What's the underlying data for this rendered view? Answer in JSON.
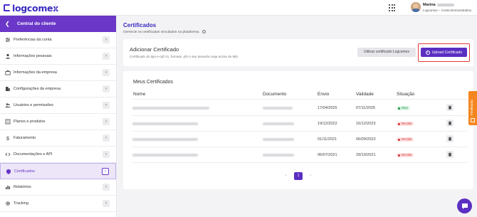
{
  "header": {
    "logo_text": "logcomex",
    "user_name": "Marina",
    "user_company": "Logcomex – Conta Demonstrativa"
  },
  "sidebar": {
    "title": "Central do cliente",
    "items": [
      {
        "label": "Preferências da conta",
        "icon": "sliders-icon"
      },
      {
        "label": "Informações pessoais",
        "icon": "user-icon"
      },
      {
        "label": "Informações da empresa",
        "icon": "briefcase-icon"
      },
      {
        "label": "Configurações da empresa",
        "icon": "building-icon"
      },
      {
        "label": "Usuários e permissões",
        "icon": "users-icon"
      },
      {
        "label": "Planos e produtos",
        "icon": "list-icon"
      },
      {
        "label": "Faturamento",
        "icon": "dollar-icon"
      },
      {
        "label": "Documentações e API",
        "icon": "code-icon"
      },
      {
        "label": "Certificados",
        "icon": "shield-icon",
        "active": true
      },
      {
        "label": "Relatórios",
        "icon": "bar-chart-icon"
      },
      {
        "label": "Tracking",
        "icon": "gear-icon"
      }
    ]
  },
  "main": {
    "title": "Certificados",
    "subtitle": "Gerencie os certificados vinculados na plataforma.",
    "add": {
      "title": "Adicionar Certificado",
      "subtitle": "Certificado do tipo e-cpf A1, formato .pfx e seu tamanho seja acima de 9kb.",
      "logcomex_button": "Utilizar certificado Logcomex",
      "upload_button": "Upload Certificado"
    },
    "list": {
      "title": "Meus Certificados",
      "columns": [
        "Nome",
        "Documento",
        "Envio",
        "Validade",
        "Situação"
      ],
      "rows": [
        {
          "envio": "17/04/2025",
          "validade": "07/11/2025",
          "situacao": "Ativo",
          "status": "ok"
        },
        {
          "envio": "19/12/2022",
          "validade": "16/12/2023",
          "situacao": "Vencido",
          "status": "bad"
        },
        {
          "envio": "01/11/2021",
          "validade": "06/09/2023",
          "situacao": "Vencido",
          "status": "bad"
        },
        {
          "envio": "06/07/2021",
          "validade": "29/10/2021",
          "situacao": "Vencido",
          "status": "bad"
        }
      ]
    },
    "pagination": {
      "prev": "‹",
      "current": "1",
      "next": "›"
    }
  },
  "feedback_label": "Feedbacks",
  "colors": {
    "accent": "#5b2fc2",
    "highlight": "#e23a3a",
    "feedback": "#f5861f"
  }
}
